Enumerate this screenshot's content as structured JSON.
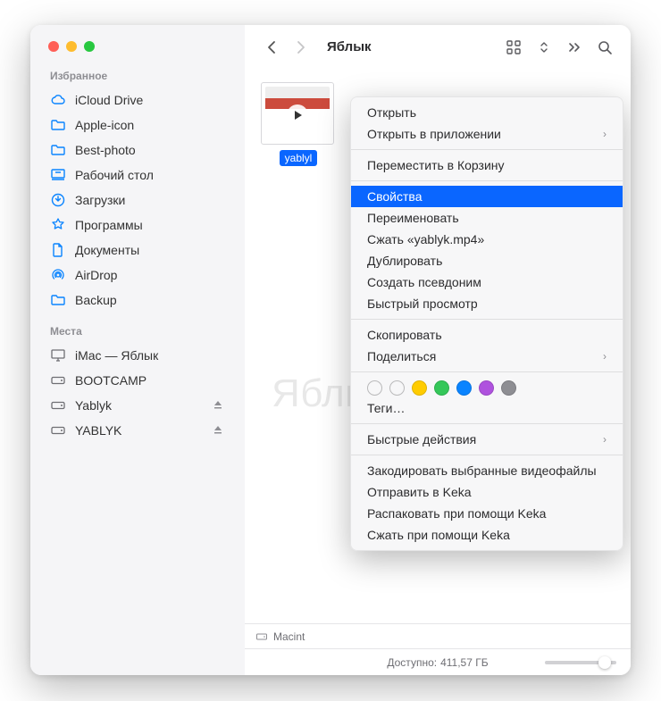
{
  "window": {
    "sidebar": {
      "favorites_label": "Избранное",
      "places_label": "Места",
      "favorites": [
        {
          "icon": "cloud",
          "label": "iCloud Drive"
        },
        {
          "icon": "folder",
          "label": "Apple-icon"
        },
        {
          "icon": "folder",
          "label": "Best-photo"
        },
        {
          "icon": "desktop",
          "label": "Рабочий стол"
        },
        {
          "icon": "downloads",
          "label": "Загрузки"
        },
        {
          "icon": "apps",
          "label": "Программы"
        },
        {
          "icon": "documents",
          "label": "Документы"
        },
        {
          "icon": "airdrop",
          "label": "AirDrop"
        },
        {
          "icon": "folder",
          "label": "Backup"
        }
      ],
      "places": [
        {
          "icon": "imac",
          "label": "iMac — Яблык",
          "eject": false
        },
        {
          "icon": "disk",
          "label": "BOOTCAMP",
          "eject": false
        },
        {
          "icon": "disk",
          "label": "Yablyk",
          "eject": true
        },
        {
          "icon": "disk",
          "label": "YABLYK",
          "eject": true
        }
      ]
    },
    "toolbar": {
      "title": "Яблык"
    },
    "file": {
      "name": "yablyk.mp4",
      "display_name": "yablyl"
    },
    "watermark": "Яблык",
    "pathbar": {
      "root": "Macint"
    },
    "statusbar": {
      "available_label": "Доступно:",
      "available_value": "411,57 ГБ"
    },
    "context_menu": {
      "open": "Открыть",
      "open_with": "Открыть в приложении",
      "trash": "Переместить в Корзину",
      "info": "Свойства",
      "rename": "Переименовать",
      "compress": "Сжать «yablyk.mp4»",
      "duplicate": "Дублировать",
      "alias": "Создать псевдоним",
      "quicklook": "Быстрый просмотр",
      "copy": "Скопировать",
      "share": "Поделиться",
      "tags_label": "Теги…",
      "quick_actions": "Быстрые действия",
      "encode": "Закодировать выбранные видеофайлы",
      "send_keka": "Отправить в Keka",
      "unpack_keka": "Распаковать при помощи Keka",
      "compress_keka": "Сжать при помощи Keka",
      "tag_colors": [
        "none",
        "none",
        "#ffcc00",
        "#34c759",
        "#0a84ff",
        "#af52de",
        "#8e8e93"
      ]
    }
  }
}
